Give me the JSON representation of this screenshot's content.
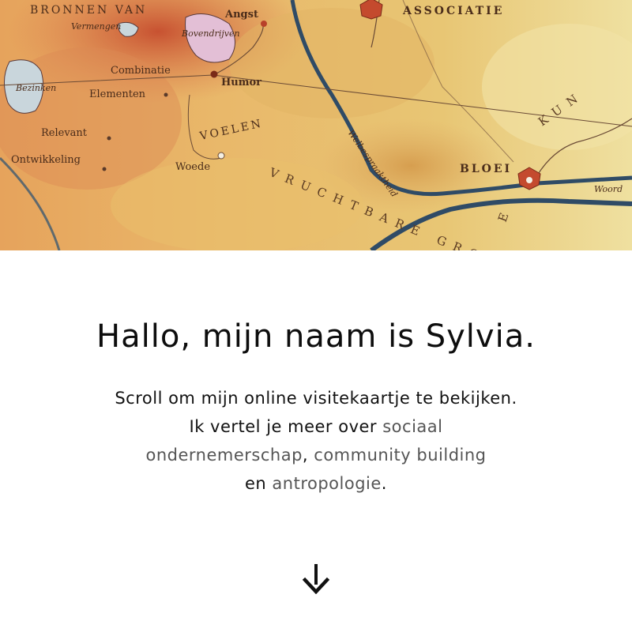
{
  "hero": {
    "map_labels": {
      "title_partial": "BRONNEN VAN",
      "vermengen": "Vermengen",
      "angst": "Angst",
      "bovendrijven": "Bovendrijven",
      "associatie": "ASSOCIATIE",
      "combinatie": "Combinatie",
      "humor": "Humor",
      "bezinken": "Bezinken",
      "elementen": "Elementen",
      "relevant": "Relevant",
      "voelen": "VOELEN",
      "ontwikkeling": "Ontwikkeling",
      "woede": "Woede",
      "welbespraaktheid": "Welbespraaktheid",
      "bloei": "BLOEI",
      "vruchtbare_gronden": "VRUCHTBARE GRONDEN",
      "kun_partial": "KUN",
      "e_partial": "E",
      "woord_partial": "Woord"
    }
  },
  "intro": {
    "heading": "Hallo, mijn naam is Sylvia.",
    "line1": "Scroll om mijn online visitekaartje te bekijken.",
    "line2_prefix": "Ik vertel je meer over ",
    "kw_sociaal": "sociaal",
    "kw_ondernemerschap": "ondernemerschap",
    "sep_comma": ", ",
    "kw_community": "community building",
    "line4_prefix": "en ",
    "kw_antropologie": "antropologie",
    "line4_suffix": "."
  },
  "colors": {
    "heading": "#0d0d0d",
    "body": "#111111",
    "keyword": "#555555",
    "background": "#ffffff"
  },
  "icons": {
    "scroll": "arrow-down-icon"
  }
}
